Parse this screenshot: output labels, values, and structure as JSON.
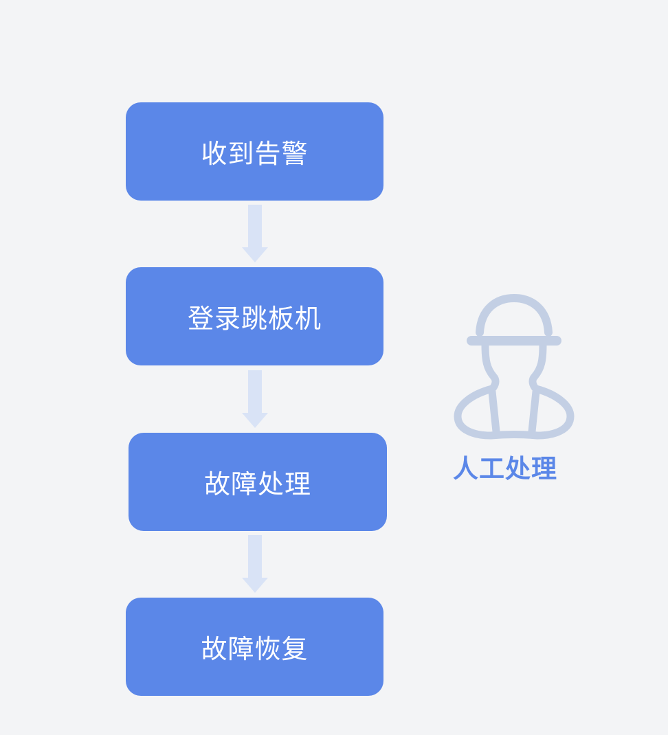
{
  "flow": {
    "steps": [
      {
        "label": "收到告警"
      },
      {
        "label": "登录跳板机"
      },
      {
        "label": "故障处理"
      },
      {
        "label": "故障恢复"
      }
    ]
  },
  "actor": {
    "label": "人工处理",
    "icon": "worker-hardhat-icon"
  },
  "colors": {
    "background": "#f3f4f6",
    "step_fill": "#5b87e8",
    "step_text": "#ffffff",
    "arrow": "#d9e3f6",
    "worker_icon": "#c3cfe4",
    "actor_label": "#5b87e8"
  }
}
